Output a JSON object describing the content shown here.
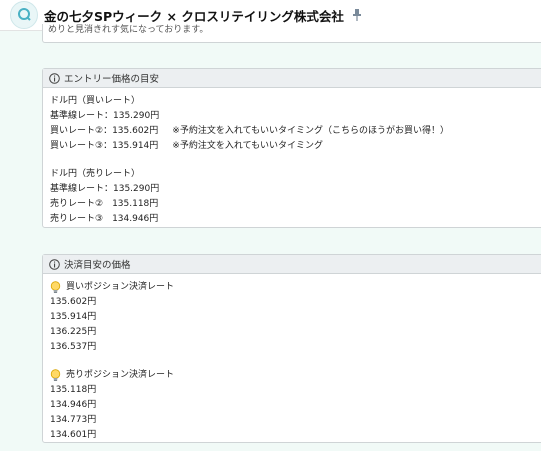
{
  "header": {
    "title": "金の七夕SPウィーク × クロスリテイリング株式会社"
  },
  "top_box": {
    "clipped_text": "めりと見消きれす気になっております。"
  },
  "entry_box": {
    "heading": "エントリー価格の目安",
    "buy_label": "ドル円（買いレート）",
    "buy_rows": [
      {
        "text": "基準線レート：135.290円",
        "note": ""
      },
      {
        "text": "買いレート②：135.602円",
        "note": "※予約注文を入れてもいいタイミング（こちらのほうがお買い得！）"
      },
      {
        "text": "買いレート③：135.914円",
        "note": "※予約注文を入れてもいいタイミング"
      }
    ],
    "sell_label": "ドル円（売りレート）",
    "sell_rows": [
      "基準線レート：135.290円",
      "売りレート②　135.118円",
      "売りレート③　134.946円"
    ]
  },
  "settle_box": {
    "heading": "決済目安の価格",
    "buy_title": "買いポジション決済レート",
    "buy_values": [
      "135.602円",
      "135.914円",
      "136.225円",
      "136.537円"
    ],
    "sell_title": "売りポジション決済レート",
    "sell_values": [
      "135.118円",
      "134.946円",
      "134.773円",
      "134.601円"
    ]
  }
}
